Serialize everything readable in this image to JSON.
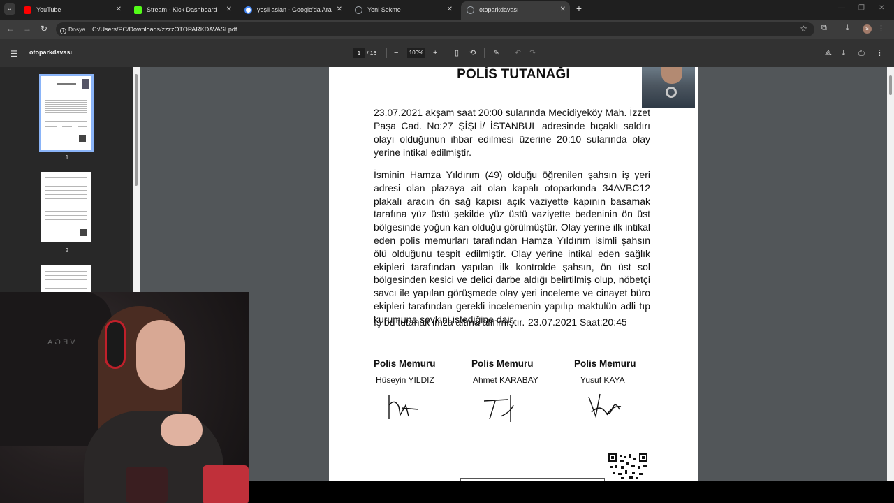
{
  "browser": {
    "tabs": [
      {
        "label": "YouTube",
        "favicon_color": "#ff0000",
        "active": false
      },
      {
        "label": "Stream - Kick Dashboard",
        "favicon_color": "#53fc18",
        "active": false
      },
      {
        "label": "yeşil aslan - Google'da Ara",
        "favicon_color": "#4285f4",
        "active": false
      },
      {
        "label": "Yeni Sekme",
        "favicon_color": "#9aa0a6",
        "active": false
      },
      {
        "label": "otoparkdavası",
        "favicon_color": "#9aa0a6",
        "active": true
      }
    ],
    "new_tab_symbol": "+",
    "close_symbol": "✕",
    "address": {
      "chip_label": "Dosya",
      "url": "C:/Users/PC/Downloads/zzzzOTOPARKDAVASI.pdf"
    },
    "profile_initial": "S"
  },
  "pdf_toolbar": {
    "document_title": "otoparkdavası",
    "current_page": "1",
    "total_pages": "/ 16",
    "zoom": "100%"
  },
  "sidebar": {
    "thumbnails": [
      {
        "number": "1",
        "selected": true
      },
      {
        "number": "2",
        "selected": false
      },
      {
        "number": "",
        "selected": false
      }
    ]
  },
  "document": {
    "title": "POLİS TUTANAĞI",
    "paragraph1": "23.07.2021 akşam saat 20:00 sularında Mecidiyeköy Mah. İzzet Paşa Cad. No:27 ŞİŞLİ/ İSTANBUL adresinde bıçaklı saldırı olayı olduğunun ihbar edilmesi üzerine 20:10 sularında olay yerine intikal edilmiştir.",
    "paragraph2": "İsminin Hamza Yıldırım (49) olduğu öğrenilen şahsın iş yeri adresi olan plazaya ait olan kapalı otoparkında 34AVBC12 plakalı aracın ön sağ kapısı açık vaziyette kapının basamak tarafına yüz üstü şekilde yüz üstü vaziyette bedeninin ön üst bölgesinde yoğun kan olduğu görülmüştür. Olay yerine ilk intikal eden polis memurları tarafından Hamza Yıldırım isimli şahsın ölü olduğunu tespit edilmiştir. Olay yerine intikal eden sağlık ekipleri tarafından yapılan ilk kontrolde şahsın, ön üst sol bölgesinden kesici ve delici darbe aldığı belirtilmiş olup, nöbetçi savcı ile yapılan görüşmede olay yeri inceleme ve cinayet büro ekipleri tarafından gerekli incelemenin yapılıp maktulün adli tıp kurumuna sevkini istediğine dair,",
    "closing_line": "İş bu tutanak imza altına alınmıştır.",
    "closing_datetime": "23.07.2021 Saat:20:45",
    "officers": [
      {
        "title": "Polis Memuru",
        "name": "Hüseyin  YILDIZ"
      },
      {
        "title": "Polis Memuru",
        "name": "Ahmet KARABAY"
      },
      {
        "title": "Polis Memuru",
        "name": "Yusuf KAYA"
      }
    ]
  },
  "webcam": {
    "chair_brand": "VEGA"
  }
}
